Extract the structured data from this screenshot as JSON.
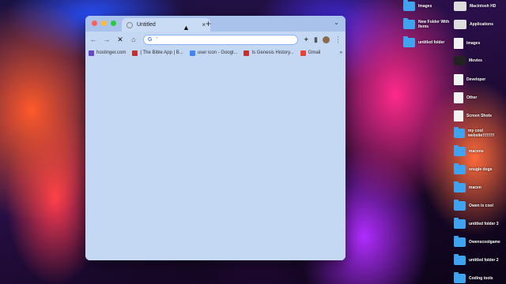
{
  "tab": {
    "title": "Untitled",
    "close": "×",
    "new": "+",
    "menu": "⌄"
  },
  "toolbar": {
    "back": "←",
    "forward": "→",
    "stop": "✕",
    "home": "⌂",
    "address": "'",
    "google_g": "G",
    "extensions": "✦",
    "sidebar": "▮",
    "menu": "⋮"
  },
  "bookmarks": [
    {
      "label": "hostinger.com",
      "color": "#6747c7"
    },
    {
      "label": "| The Bible App | B...",
      "color": "#c4302b"
    },
    {
      "label": "user icon - Googl...",
      "color": "#4285f4"
    },
    {
      "label": "Is Genesis History...",
      "color": "#c4302b"
    },
    {
      "label": "Gmail",
      "color": "#ea4335"
    }
  ],
  "bookmarks_more": "»",
  "desktop": [
    {
      "label": "Images",
      "type": "folder",
      "col": 0
    },
    {
      "label": "Macintosh HD",
      "type": "disk",
      "col": 1
    },
    {
      "label": "New Folder With Items",
      "type": "folder",
      "col": 0
    },
    {
      "label": "Applications",
      "type": "disk",
      "col": 1
    },
    {
      "label": "untitled folder",
      "type": "folder",
      "col": 0
    },
    {
      "label": "Images",
      "type": "doc",
      "col": 1
    },
    {
      "label": "Movies",
      "type": "dark",
      "col": 1
    },
    {
      "label": "Developer",
      "type": "doc",
      "col": 1
    },
    {
      "label": "Other",
      "type": "doc",
      "col": 1
    },
    {
      "label": "Screen Shots",
      "type": "doc",
      "col": 1
    },
    {
      "label": "my cool website!!!!!!!!!",
      "type": "folder",
      "col": 1
    },
    {
      "label": "macens",
      "type": "folder",
      "col": 1
    },
    {
      "label": "snugle dogs",
      "type": "folder",
      "col": 1
    },
    {
      "label": "macen",
      "type": "folder",
      "col": 1
    },
    {
      "label": "Owen is cool",
      "type": "folder",
      "col": 1
    },
    {
      "label": "untitled folder 3",
      "type": "folder",
      "col": 1
    },
    {
      "label": "Owenscoolgame",
      "type": "folder",
      "col": 1
    },
    {
      "label": "untitled folder 2",
      "type": "folder",
      "col": 1
    },
    {
      "label": "Coding tools",
      "type": "folder",
      "col": 1
    }
  ]
}
